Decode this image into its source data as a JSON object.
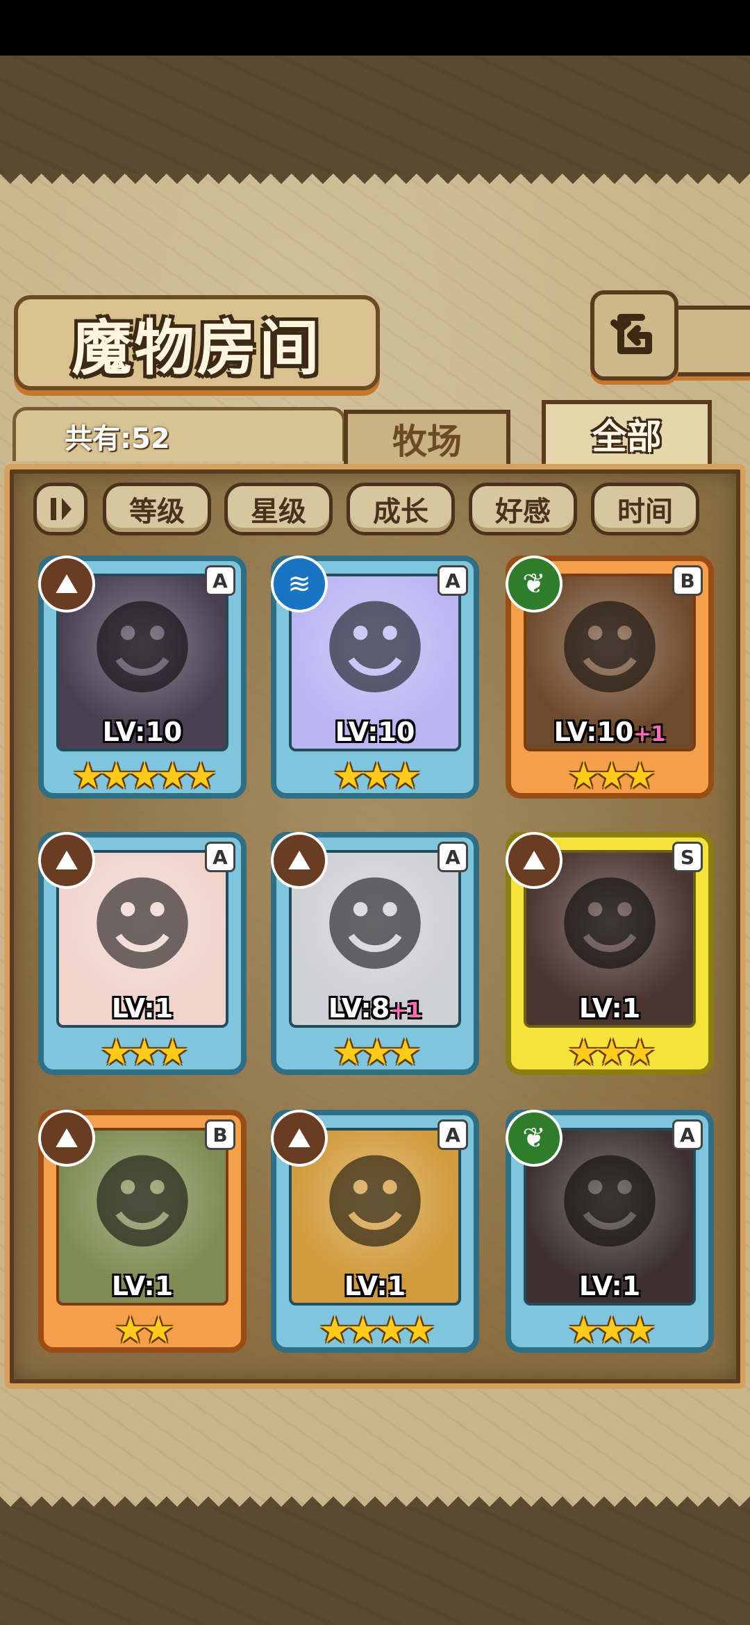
{
  "header": {
    "title": "魔物房间"
  },
  "count": {
    "label": "共有:52"
  },
  "tabs": [
    {
      "label": "牧场"
    },
    {
      "label": "全部"
    }
  ],
  "sort": {
    "toggle_icon": "sort-toggle-icon",
    "buttons": [
      "等级",
      "星级",
      "成长",
      "好感",
      "时间"
    ]
  },
  "monsters": [
    {
      "rank": "A",
      "element": "earth",
      "level": "LV:10",
      "bonus": "",
      "stars": "★★★★★",
      "frame": "blue",
      "portrait": "#4a3f52"
    },
    {
      "rank": "A",
      "element": "water",
      "level": "LV:10",
      "bonus": "",
      "stars": "★★★",
      "frame": "blue",
      "portrait": "#b9b6f3"
    },
    {
      "rank": "B",
      "element": "leaf",
      "level": "LV:10",
      "bonus": "+1",
      "stars": "★★★",
      "frame": "orange",
      "portrait": "#6e4a2c"
    },
    {
      "rank": "A",
      "element": "earth",
      "level": "LV:1",
      "bonus": "",
      "stars": "★★★",
      "frame": "blue",
      "portrait": "#f0d4cc"
    },
    {
      "rank": "A",
      "element": "earth",
      "level": "LV:8",
      "bonus": "+1",
      "stars": "★★★",
      "frame": "blue",
      "portrait": "#cfcfd6"
    },
    {
      "rank": "S",
      "element": "earth",
      "level": "LV:1",
      "bonus": "",
      "stars": "★★★",
      "frame": "yellow",
      "portrait": "#4a3530"
    },
    {
      "rank": "B",
      "element": "earth",
      "level": "LV:1",
      "bonus": "",
      "stars": "★★",
      "frame": "orange",
      "portrait": "#7f8b52"
    },
    {
      "rank": "A",
      "element": "earth",
      "level": "LV:1",
      "bonus": "",
      "stars": "★★★★",
      "frame": "blue",
      "portrait": "#d19a3a"
    },
    {
      "rank": "A",
      "element": "leaf",
      "level": "LV:1",
      "bonus": "",
      "stars": "★★★",
      "frame": "blue",
      "portrait": "#3c3030"
    }
  ]
}
